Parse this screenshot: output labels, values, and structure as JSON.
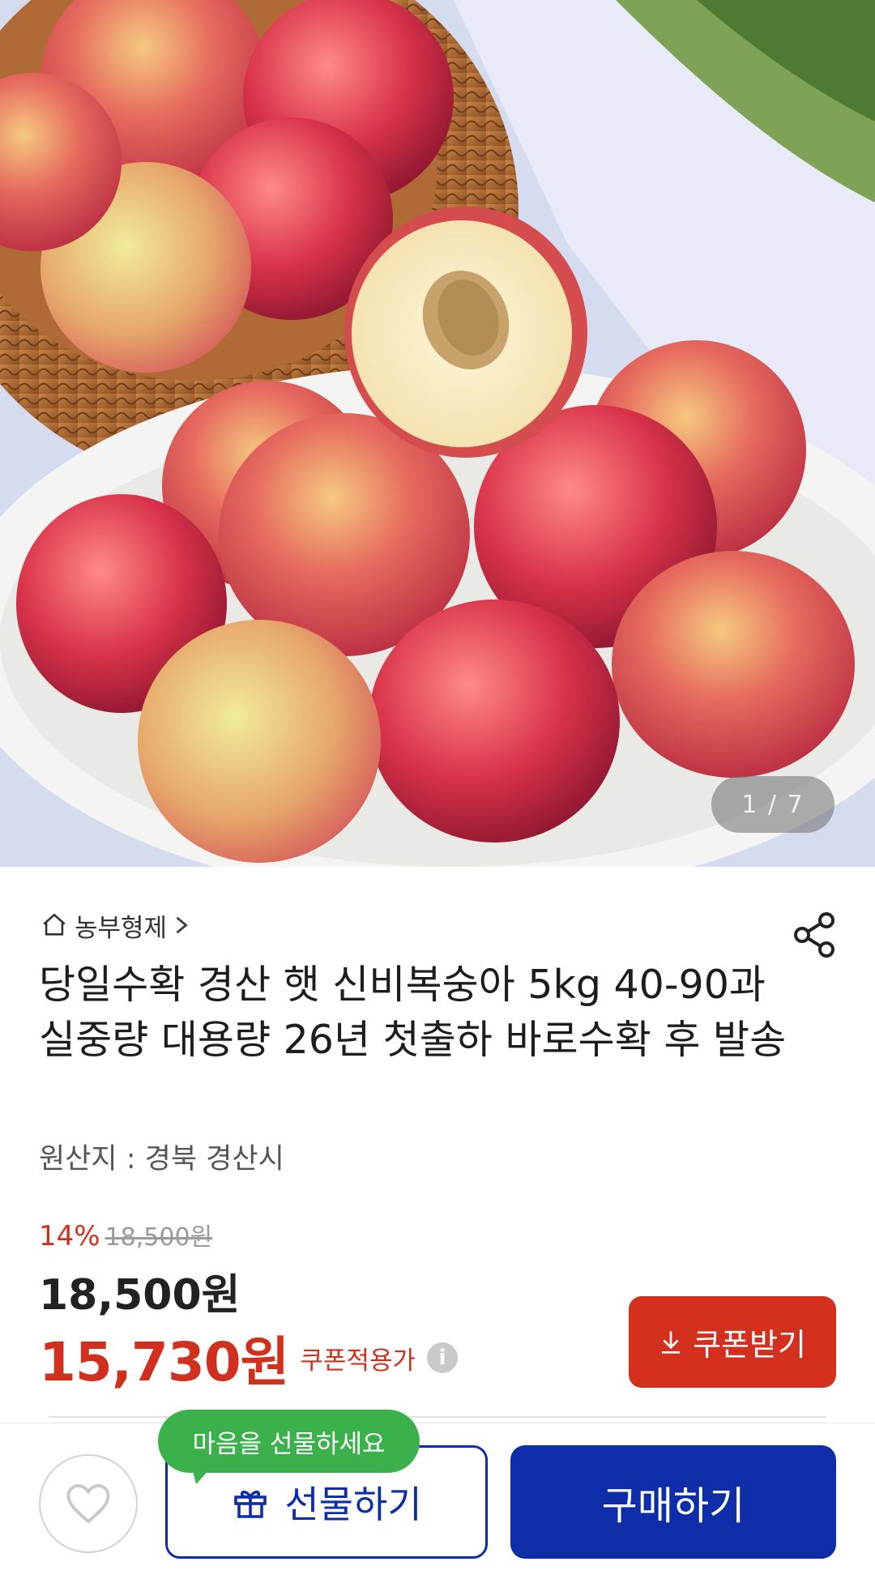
{
  "gallery": {
    "counter": "1 / 7"
  },
  "store": {
    "name": "농부형제"
  },
  "product": {
    "title": "당일수확 경산 햇 신비복숭아 5kg 40-90과 실중량 대용량 26년 첫출하 바로수확 후 발송",
    "origin": "원산지 : 경북 경산시"
  },
  "pricing": {
    "discount": "14%",
    "original_price": "18,500원",
    "price": "18,500원",
    "coupon_price": "15,730원",
    "coupon_note": "쿠폰적용가",
    "coupon_button": "쿠폰받기"
  },
  "actions": {
    "gift_bubble": "마음을 선물하세요",
    "gift_button": "선물하기",
    "buy_button": "구매하기"
  },
  "colors": {
    "accent_red": "#d3301d",
    "brand_blue": "#0d2ea8",
    "bubble_green": "#3ab14a"
  }
}
